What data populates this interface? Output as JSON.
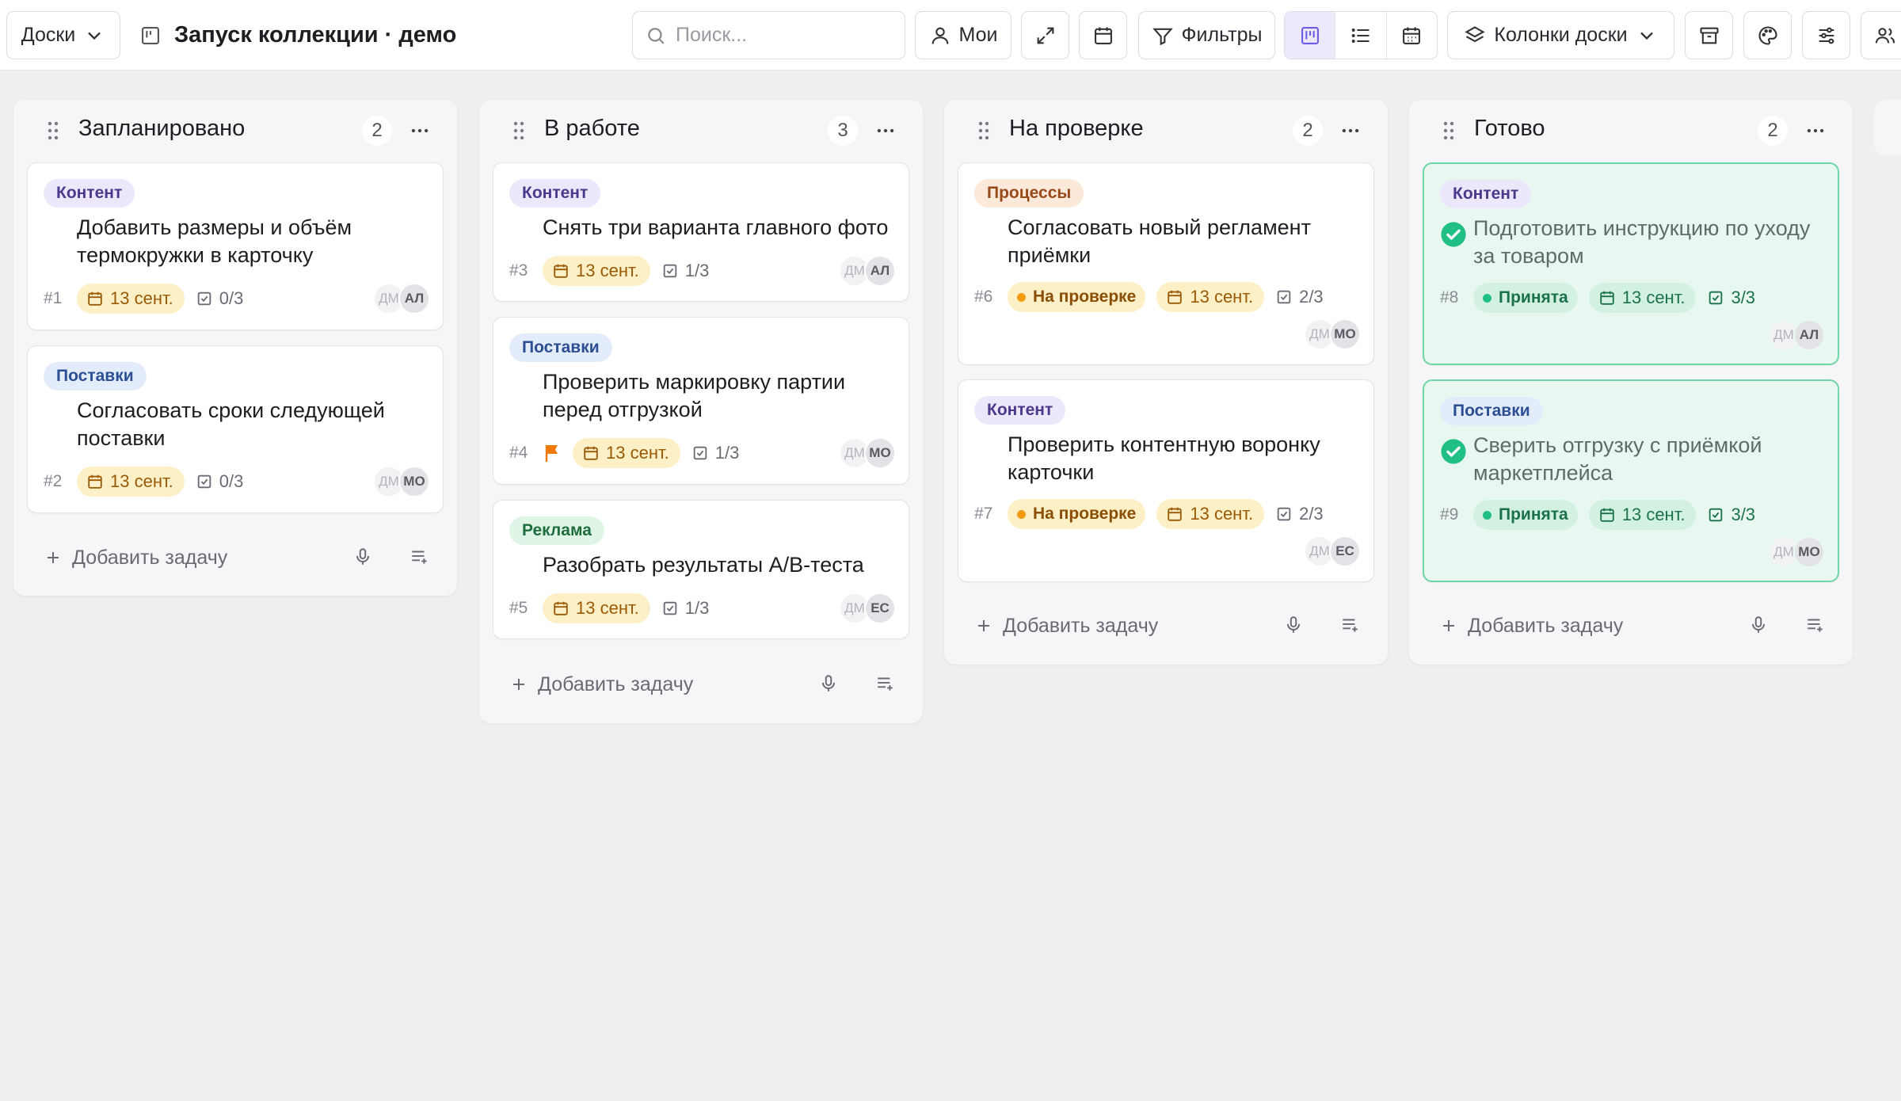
{
  "toolbar": {
    "boards_label": "Доски",
    "board_title": "Запуск коллекции · демо",
    "search_placeholder": "Поиск...",
    "mine_label": "Мои",
    "filters_label": "Фильтры",
    "columns_label": "Колонки доски",
    "active_view": "board"
  },
  "columns": [
    {
      "title": "Запланировано",
      "count": "2"
    },
    {
      "title": "В работе",
      "count": "3"
    },
    {
      "title": "На проверке",
      "count": "2"
    },
    {
      "title": "Готово",
      "count": "2"
    }
  ],
  "add_task_label": "Добавить задачу",
  "cards": {
    "c1": {
      "tag": "Контент",
      "title": "Добавить размеры и объём термокружки в карточку",
      "num": "#1",
      "date": "13 сент.",
      "checklist": "0/3",
      "assignee": "ДМ",
      "owner": "АЛ"
    },
    "c2": {
      "tag": "Поставки",
      "title": "Согласовать сроки следующей поставки",
      "num": "#2",
      "date": "13 сент.",
      "checklist": "0/3",
      "assignee": "ДМ",
      "owner": "МО"
    },
    "c3": {
      "tag": "Контент",
      "title": "Снять три варианта главного фото",
      "num": "#3",
      "date": "13 сент.",
      "checklist": "1/3",
      "assignee": "ДМ",
      "owner": "АЛ"
    },
    "c4": {
      "tag": "Поставки",
      "title": "Проверить маркировку партии перед отгрузкой",
      "num": "#4",
      "date": "13 сент.",
      "checklist": "1/3",
      "assignee": "ДМ",
      "owner": "МО",
      "flag": "flag-icon"
    },
    "c5": {
      "tag": "Реклама",
      "title": "Разобрать результаты A/B-теста",
      "num": "#5",
      "date": "13 сент.",
      "checklist": "1/3",
      "assignee": "ДМ",
      "owner": "ЕС"
    },
    "c6": {
      "tag": "Процессы",
      "title": "Согласовать новый регламент приёмки",
      "num": "#6",
      "status": "На проверке",
      "date": "13 сент.",
      "checklist": "2/3",
      "assignee": "ДМ",
      "owner": "МО"
    },
    "c7": {
      "tag": "Контент",
      "title": "Проверить контентную воронку карточки",
      "num": "#7",
      "status": "На проверке",
      "date": "13 сент.",
      "checklist": "2/3",
      "assignee": "ДМ",
      "owner": "ЕС"
    },
    "c8": {
      "tag": "Контент",
      "title": "Подготовить инструкцию по уходу за товаром",
      "num": "#8",
      "status": "Принята",
      "date": "13 сент.",
      "checklist": "3/3",
      "assignee": "ДМ",
      "owner": "АЛ"
    },
    "c9": {
      "tag": "Поставки",
      "title": "Сверить отгрузку с приёмкой маркетплейса",
      "num": "#9",
      "status": "Принята",
      "date": "13 сент.",
      "checklist": "3/3",
      "assignee": "ДМ",
      "owner": "МО"
    }
  },
  "colors": {
    "accent": "#6c5ce7",
    "done_border": "#6fd6a5",
    "date_chip": "#fdf0c7",
    "flag": "#f07a0c",
    "check_done": "#1fbf85"
  }
}
